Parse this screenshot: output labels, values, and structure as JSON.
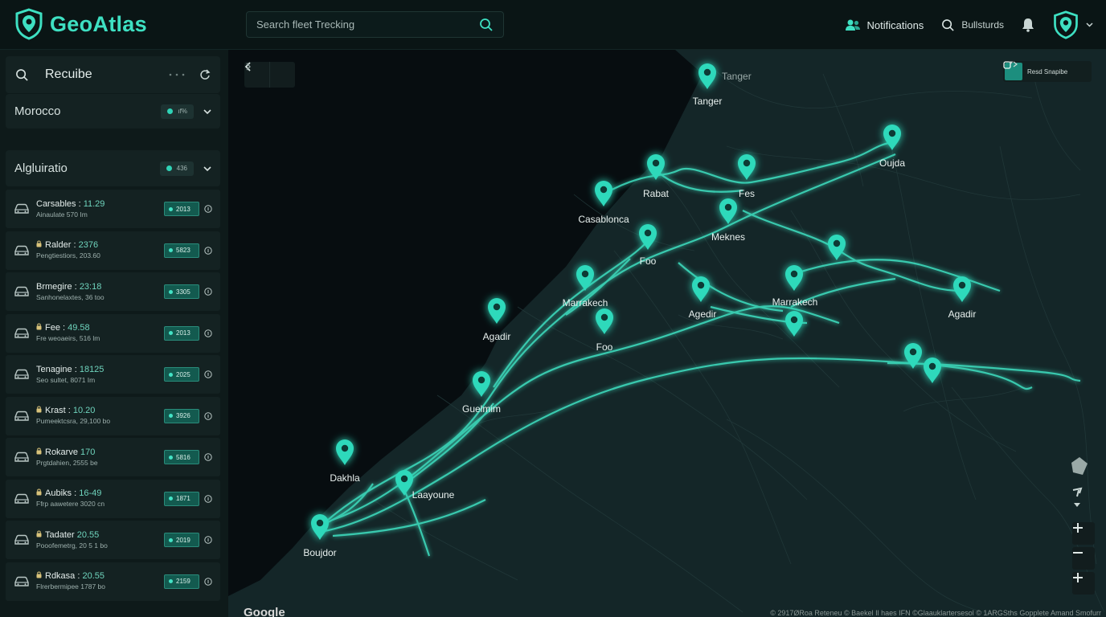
{
  "app": {
    "name": "GeoAtlas"
  },
  "search": {
    "placeholder": "Search fleet Trecking"
  },
  "header": {
    "notifications_label": "Notifications",
    "bookmarks_label": "Bullsturds",
    "icons": [
      "shield-logo-icon",
      "search-icon",
      "users-icon",
      "bell-icon",
      "avatar-icon",
      "chevron-down-icon"
    ]
  },
  "sidebar": {
    "header": {
      "title": "Recuibe"
    },
    "region": {
      "label": "Morocco",
      "badge": "ıf%"
    },
    "group": {
      "label": "Algluiratio",
      "badge": "436"
    },
    "vehicles": [
      {
        "name": "Carsables :",
        "number": "11.29",
        "sub": "Ainaulate 570 Im",
        "badge": "2013",
        "lock": false
      },
      {
        "name": "Ralder :",
        "number": "2376",
        "sub": "Pengtiestiors, 203.60",
        "badge": "5823",
        "lock": true
      },
      {
        "name": "Brmegire :",
        "number": "23:18",
        "sub": "Sanhonelaxtes, 36 too",
        "badge": "3305",
        "lock": false
      },
      {
        "name": "Fee :",
        "number": "49.58",
        "sub": "Fre weoaeirs, 516 lm",
        "badge": "2013",
        "lock": true
      },
      {
        "name": "Tenagine :",
        "number": "18125",
        "sub": "Seo sultet, 8071 Im",
        "badge": "2025",
        "lock": false
      },
      {
        "name": "Krast :",
        "number": "10.20",
        "sub": "Pumeektcsra, 29,100 bo",
        "badge": "3926",
        "lock": true
      },
      {
        "name": "Rokarve",
        "number": "170",
        "sub": "Prgtdahien, 2555 be",
        "badge": "5816",
        "lock": true
      },
      {
        "name": "Aubiks :",
        "number": "16-49",
        "sub": "Ffrp aawetere 3020 cn",
        "badge": "1871",
        "lock": true
      },
      {
        "name": "Tadater",
        "number": "20.55",
        "sub": "Pooofemetrg, 20 5 1 bo",
        "badge": "2019",
        "lock": true
      },
      {
        "name": "Rdkasa :",
        "number": "20.55",
        "sub": "Flrerbermipee 1787 bo",
        "badge": "2159",
        "lock": true
      }
    ]
  },
  "map": {
    "layer_label": "Resd Snapibe",
    "google_label": "Google",
    "attribution": "© 2917ØRoa Reteneu   © Baekel Il haes IFN   ©Glaauklartersesol   © 1ARGSths   Gopplete Amand Smofurr",
    "cities": [
      "Tanger",
      "Oujda",
      "Rabat",
      "Fes",
      "Casablonca",
      "Meknes",
      "Foo",
      "Marrakech",
      "Agedir",
      "Marrakech",
      "Agadir",
      "Agadir",
      "Foo",
      "Guelmim",
      "Dakhla",
      "Laayoune",
      "Boujdor"
    ],
    "faint_label": "Tanger",
    "controls": [
      "back-icon",
      "forward-icon",
      "terrain-icon",
      "compass-icon",
      "zoom-in-icon",
      "zoom-out-icon",
      "zoom-in-icon"
    ]
  },
  "colors": {
    "accent": "#3ee0c2",
    "background": "#0b1616",
    "route": "#3fe6c6"
  }
}
